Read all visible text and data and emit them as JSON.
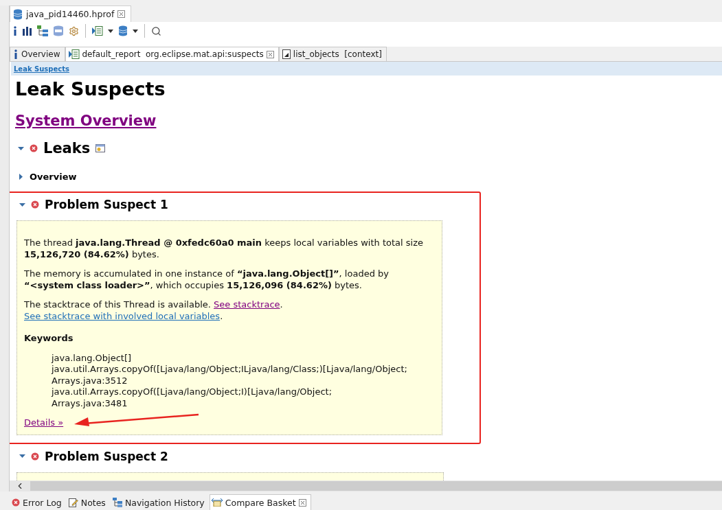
{
  "editor_tab": {
    "title": "java_pid14460.hprof"
  },
  "sub_tabs": [
    {
      "label": "Overview",
      "selected": false,
      "closable": false
    },
    {
      "label": "default_report  org.eclipse.mat.api:suspects",
      "selected": true,
      "closable": true
    },
    {
      "label": "list_objects  [context]",
      "selected": false,
      "closable": false
    }
  ],
  "breadcrumb": "Leak Suspects",
  "page_title": "Leak Suspects",
  "system_overview_link": "System Overview",
  "leaks": {
    "title": "Leaks",
    "expanded": true
  },
  "overview": {
    "title": "Overview",
    "expanded": false
  },
  "suspects": [
    {
      "title": "Problem Suspect 1",
      "expanded": true,
      "highlighted": true,
      "paragraphs": [
        "The thread **java.lang.Thread @ 0xfedc60a0 main** keeps local variables with total size **15,126,720 (84.62%)** bytes.",
        "The memory is accumulated in one instance of **“java.lang.Object[]”**, loaded by **“<system class loader>”**, which occupies **15,126,096 (84.62%)** bytes."
      ],
      "stacktrace_parts": [
        {
          "kind": "text",
          "text": "The stacktrace of this Thread is available. "
        },
        {
          "kind": "link",
          "text": "See stacktrace",
          "visited": true
        },
        {
          "kind": "text",
          "text": ". "
        },
        {
          "kind": "link",
          "text": "See stacktrace with involved local variables",
          "visited": false
        },
        {
          "kind": "text",
          "text": "."
        }
      ],
      "keywords_title": "Keywords",
      "keywords": [
        "java.lang.Object[]",
        "java.util.Arrays.copyOf([Ljava/lang/Object;ILjava/lang/Class;)[Ljava/lang/Object;",
        "Arrays.java:3512",
        "java.util.Arrays.copyOf([Ljava/lang/Object;I)[Ljava/lang/Object;",
        "Arrays.java:3481"
      ],
      "details_link": "Details »"
    },
    {
      "title": "Problem Suspect 2",
      "expanded": true
    }
  ],
  "bottom_tabs": [
    {
      "label": "Error Log",
      "selected": false
    },
    {
      "label": "Notes",
      "selected": false
    },
    {
      "label": "Navigation History",
      "selected": false
    },
    {
      "label": "Compare Basket",
      "selected": true
    }
  ]
}
